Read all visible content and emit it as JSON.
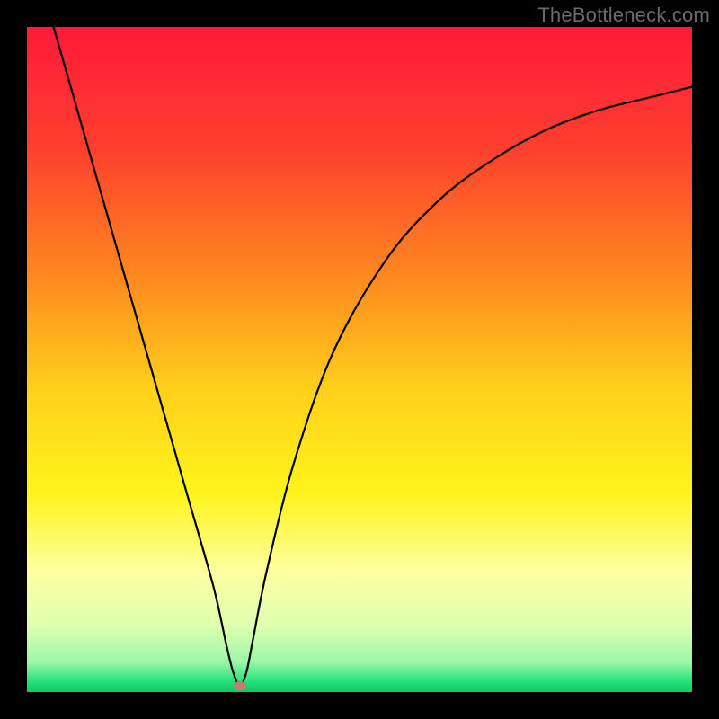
{
  "watermark": "TheBottleneck.com",
  "chart_data": {
    "type": "line",
    "title": "",
    "xlabel": "",
    "ylabel": "",
    "xlim": [
      0,
      100
    ],
    "ylim": [
      0,
      100
    ],
    "x": [
      4,
      8,
      12,
      16,
      20,
      24,
      28,
      30,
      31,
      32,
      33,
      34,
      36,
      40,
      46,
      54,
      62,
      70,
      78,
      86,
      94,
      100
    ],
    "values": [
      100,
      86,
      72,
      58,
      44,
      30,
      16,
      7,
      3,
      1,
      3,
      8,
      18,
      34,
      51,
      65,
      74,
      80,
      84.5,
      87.5,
      89.5,
      91
    ],
    "gradient_stops": [
      {
        "offset": 0.0,
        "color": "#ff1a3a"
      },
      {
        "offset": 0.18,
        "color": "#ff3e2e"
      },
      {
        "offset": 0.38,
        "color": "#ff8a1f"
      },
      {
        "offset": 0.55,
        "color": "#ffd21a"
      },
      {
        "offset": 0.7,
        "color": "#fff41a"
      },
      {
        "offset": 0.82,
        "color": "#fdffa0"
      },
      {
        "offset": 0.9,
        "color": "#dfffb0"
      },
      {
        "offset": 0.955,
        "color": "#9cf7a8"
      },
      {
        "offset": 0.985,
        "color": "#22e07a"
      },
      {
        "offset": 1.0,
        "color": "#14c668"
      }
    ],
    "marker": {
      "x": 32,
      "y": 1,
      "color": "#c77b6e"
    }
  }
}
